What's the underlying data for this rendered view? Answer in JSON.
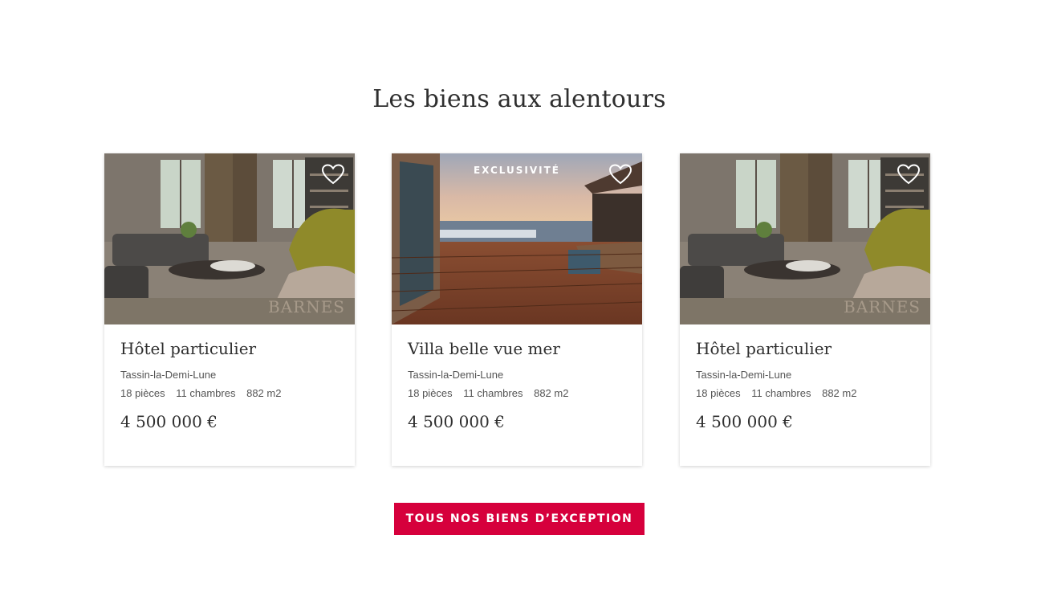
{
  "section": {
    "title": "Les biens aux alentours"
  },
  "cards": [
    {
      "title": "Hôtel particulier",
      "location": "Tassin-la-Demi-Lune",
      "rooms": "18 pièces",
      "bedrooms": "11 chambres",
      "area": "882 m2",
      "price": "4 500 000 €",
      "badge": "",
      "watermark": "BARNES",
      "image": "living-room-photo",
      "favorite_icon": "heart-outline-icon"
    },
    {
      "title": "Villa belle vue mer",
      "location": "Tassin-la-Demi-Lune",
      "rooms": "18 pièces",
      "bedrooms": "11 chambres",
      "area": "882 m2",
      "price": "4 500 000 €",
      "badge": "EXCLUSIVITÉ",
      "watermark": "",
      "image": "sea-view-terrace-photo",
      "favorite_icon": "heart-outline-icon"
    },
    {
      "title": "Hôtel particulier",
      "location": "Tassin-la-Demi-Lune",
      "rooms": "18 pièces",
      "bedrooms": "11 chambres",
      "area": "882 m2",
      "price": "4 500 000 €",
      "badge": "",
      "watermark": "BARNES",
      "image": "living-room-photo",
      "favorite_icon": "heart-outline-icon"
    }
  ],
  "cta": {
    "label": "TOUS NOS BIENS D’EXCEPTION"
  },
  "colors": {
    "accent": "#d6003c",
    "text": "#333333",
    "background": "#ffffff"
  }
}
